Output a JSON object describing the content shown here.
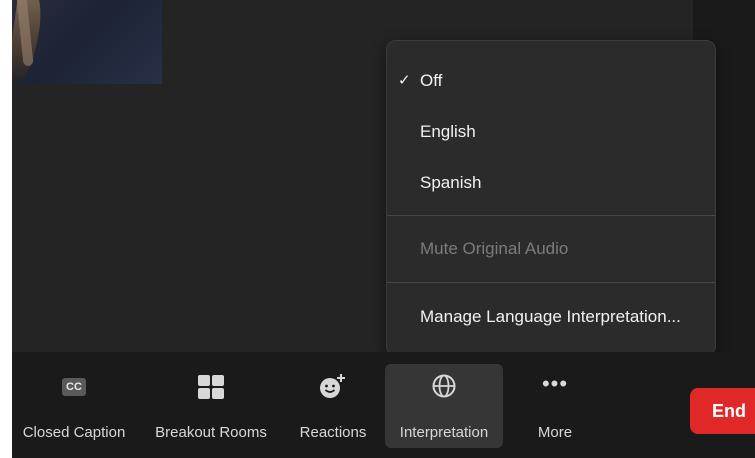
{
  "menu": {
    "items": [
      {
        "label": "Off",
        "checked": true
      },
      {
        "label": "English"
      },
      {
        "label": "Spanish"
      }
    ],
    "mute_original_audio": "Mute Original Audio",
    "manage": "Manage Language Interpretation...",
    "check_mark": "✓"
  },
  "toolbar": {
    "closed_caption": {
      "label": "Closed Caption",
      "icon": "cc-icon",
      "icon_text": "CC"
    },
    "breakout_rooms": {
      "label": "Breakout Rooms",
      "icon": "grid-icon"
    },
    "reactions": {
      "label": "Reactions",
      "icon": "smiley-plus-icon"
    },
    "interpretation": {
      "label": "Interpretation",
      "icon": "globe-icon",
      "active": true
    },
    "more": {
      "label": "More",
      "icon": "more-icon",
      "icon_text": "•••"
    },
    "end": {
      "label": "End"
    }
  },
  "colors": {
    "end_button": "#e02828",
    "menu_background": "#2b2b2b",
    "toolbar_background": "#1a1a1a"
  }
}
